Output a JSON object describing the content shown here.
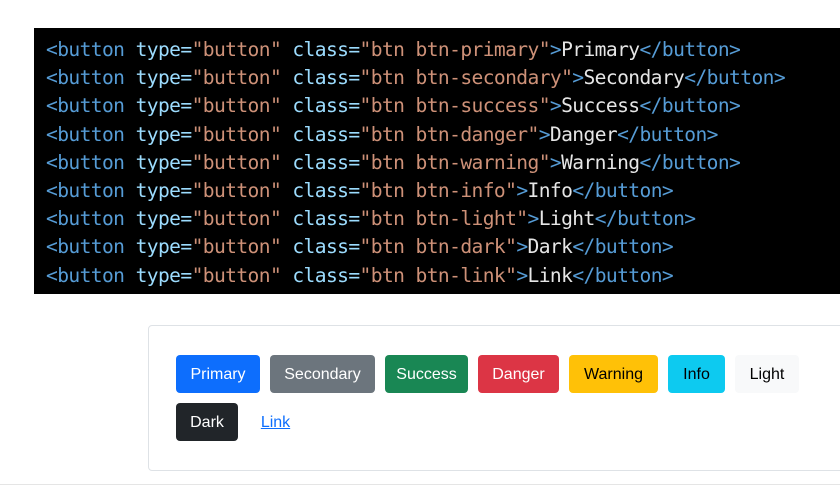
{
  "code_snippet": {
    "lines": [
      {
        "open_tag": "<button",
        "attr1": "type=",
        "val1": "\"button\"",
        "attr2": "class=",
        "val2": "\"btn btn-primary\"",
        "close_open": ">",
        "text": "Primary",
        "close_tag": "</button>",
        "end": ">"
      },
      {
        "open_tag": "<button",
        "attr1": "type=",
        "val1": "\"button\"",
        "attr2": "class=",
        "val2": "\"btn btn-secondary\"",
        "close_open": ">",
        "text": "Secondary",
        "close_tag": "</button>",
        "end": ">"
      },
      {
        "open_tag": "<button",
        "attr1": "type=",
        "val1": "\"button\"",
        "attr2": "class=",
        "val2": "\"btn btn-success\"",
        "close_open": ">",
        "text": "Success",
        "close_tag": "</button>",
        "end": ">"
      },
      {
        "open_tag": "<button",
        "attr1": "type=",
        "val1": "\"button\"",
        "attr2": "class=",
        "val2": "\"btn btn-danger\"",
        "close_open": ">",
        "text": "Danger",
        "close_tag": "</button>",
        "end": ">"
      },
      {
        "open_tag": "<button",
        "attr1": "type=",
        "val1": "\"button\"",
        "attr2": "class=",
        "val2": "\"btn btn-warning\"",
        "close_open": ">",
        "text": "Warning",
        "close_tag": "</button>",
        "end": ">"
      },
      {
        "open_tag": "<button",
        "attr1": "type=",
        "val1": "\"button\"",
        "attr2": "class=",
        "val2": "\"btn btn-info\"",
        "close_open": ">",
        "text": "Info",
        "close_tag": "</button>",
        "end": ">"
      },
      {
        "open_tag": "<button",
        "attr1": "type=",
        "val1": "\"button\"",
        "attr2": "class=",
        "val2": "\"btn btn-light\"",
        "close_open": ">",
        "text": "Light",
        "close_tag": "</button>",
        "end": ">"
      },
      {
        "open_tag": "<button",
        "attr1": "type=",
        "val1": "\"button\"",
        "attr2": "class=",
        "val2": "\"btn btn-dark\"",
        "close_open": ">",
        "text": "Dark",
        "close_tag": "</button>",
        "end": ">"
      },
      {
        "open_tag": "<button",
        "attr1": "type=",
        "val1": "\"button\"",
        "attr2": "class=",
        "val2": "\"btn btn-link\"",
        "close_open": ">",
        "text": "Link",
        "close_tag": "</button>",
        "end": ">"
      }
    ],
    "colors": {
      "background": "#000000",
      "tag": "#569cd6",
      "attribute": "#9cdcfe",
      "string": "#ce9178",
      "text": "#e6e6e6"
    }
  },
  "preview": {
    "buttons": {
      "primary": "Primary",
      "secondary": "Secondary",
      "success": "Success",
      "danger": "Danger",
      "warning": "Warning",
      "info": "Info",
      "light": "Light",
      "dark": "Dark",
      "link": "Link"
    },
    "colors": {
      "primary": "#0d6efd",
      "secondary": "#6c757d",
      "success": "#198754",
      "danger": "#dc3545",
      "warning": "#ffc107",
      "info": "#0dcaf0",
      "light": "#f8f9fa",
      "dark": "#212529"
    }
  }
}
